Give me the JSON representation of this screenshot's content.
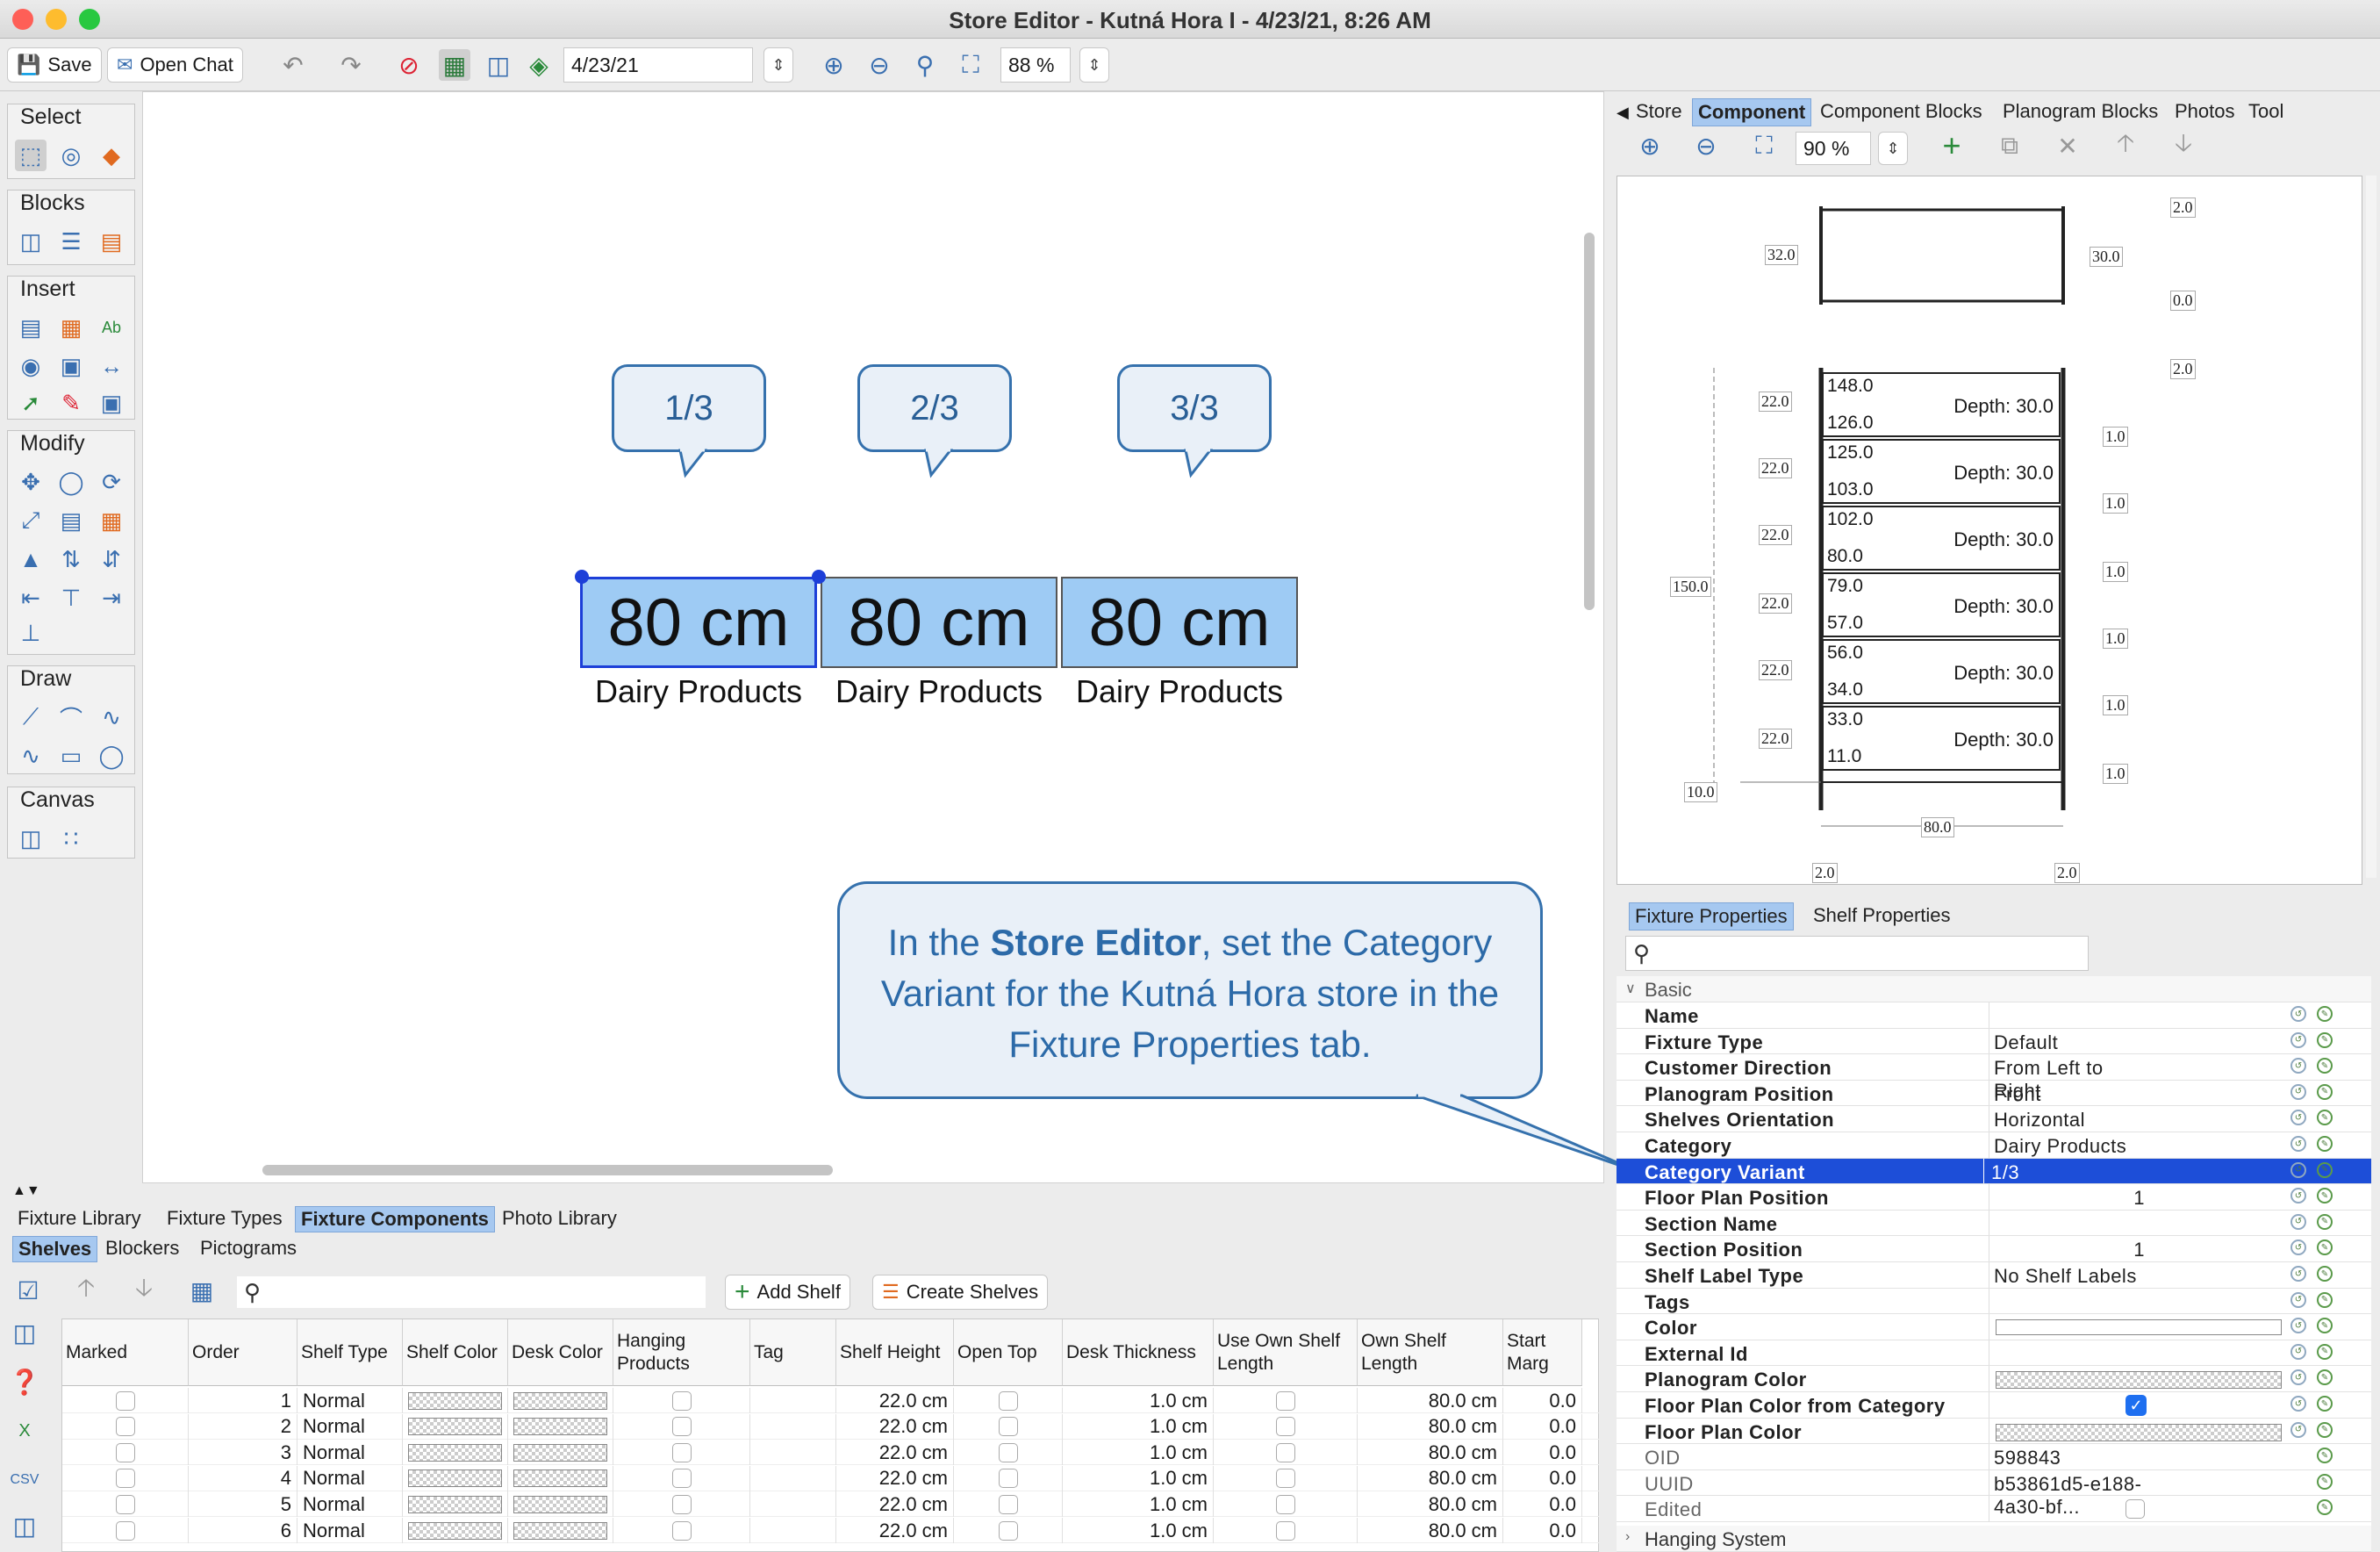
{
  "window": {
    "title": "Store Editor - Kutná Hora I - 4/23/21, 8:26 AM"
  },
  "toolbar": {
    "save_label": "Save",
    "open_chat_label": "Open Chat",
    "date_value": "4/23/21",
    "zoom_value": "88 %"
  },
  "palette": {
    "groups": [
      "Select",
      "Blocks",
      "Insert",
      "Modify",
      "Draw",
      "Canvas"
    ]
  },
  "canvas": {
    "labels": [
      "1/3",
      "2/3",
      "3/3"
    ],
    "shelf_lengths": [
      "80 cm",
      "80 cm",
      "80 cm"
    ],
    "categories": [
      "Dairy Products",
      "Dairy Products",
      "Dairy Products"
    ]
  },
  "callout": {
    "pre": "In the ",
    "bold": "Store Editor",
    "post": ", set the Category Variant for the Kutná Hora store in the Fixture Properties tab."
  },
  "right_tabs": [
    "Store",
    "Component",
    "Component Blocks",
    "Planogram Blocks",
    "Photos",
    "Tool"
  ],
  "right_zoom": "90 %",
  "preview": {
    "top_dims": [
      "2.0",
      "32.0",
      "30.0",
      "0.0",
      "2.0"
    ],
    "shelves": [
      {
        "top": "148.0",
        "bottom": "126.0",
        "depth": "Depth: 30.0",
        "h": "22.0",
        "t": "1.0"
      },
      {
        "top": "125.0",
        "bottom": "103.0",
        "depth": "Depth: 30.0",
        "h": "22.0",
        "t": "1.0"
      },
      {
        "top": "102.0",
        "bottom": "80.0",
        "depth": "Depth: 30.0",
        "h": "22.0",
        "t": "1.0"
      },
      {
        "top": "79.0",
        "bottom": "57.0",
        "depth": "Depth: 30.0",
        "h": "22.0",
        "t": "1.0"
      },
      {
        "top": "56.0",
        "bottom": "34.0",
        "depth": "Depth: 30.0",
        "h": "22.0",
        "t": "1.0"
      },
      {
        "top": "33.0",
        "bottom": "11.0",
        "depth": "Depth: 30.0",
        "h": "22.0",
        "t": "1.0"
      }
    ],
    "total_height": "150.0",
    "base": "10.0",
    "width": "80.0",
    "side_left": "2.0",
    "side_right": "2.0"
  },
  "prop_tabs": [
    "Fixture Properties",
    "Shelf Properties"
  ],
  "properties": {
    "group_basic": "Basic",
    "rows": [
      {
        "name": "Name",
        "value": ""
      },
      {
        "name": "Fixture Type",
        "value": "Default"
      },
      {
        "name": "Customer Direction",
        "value": "From Left to Right"
      },
      {
        "name": "Planogram Position",
        "value": "Front"
      },
      {
        "name": "Shelves Orientation",
        "value": "Horizontal"
      },
      {
        "name": "Category",
        "value": "Dairy Products"
      },
      {
        "name": "Category Variant",
        "value": "1/3"
      },
      {
        "name": "Floor Plan Position",
        "value": "1"
      },
      {
        "name": "Section Name",
        "value": ""
      },
      {
        "name": "Section Position",
        "value": "1"
      },
      {
        "name": "Shelf Label Type",
        "value": "No Shelf Labels"
      },
      {
        "name": "Tags",
        "value": ""
      },
      {
        "name": "Color",
        "value": ""
      },
      {
        "name": "External Id",
        "value": ""
      },
      {
        "name": "Planogram Color",
        "value": ""
      },
      {
        "name": "Floor Plan Color from Category",
        "value": ""
      },
      {
        "name": "Floor Plan Color",
        "value": ""
      },
      {
        "name": "OID",
        "value": "598843"
      },
      {
        "name": "UUID",
        "value": "b53861d5-e188-4a30-bf..."
      },
      {
        "name": "Edited",
        "value": ""
      }
    ],
    "group_hanging": "Hanging System"
  },
  "bottom_tabs": [
    "Fixture Library",
    "Fixture Types",
    "Fixture Components",
    "Photo Library"
  ],
  "sub_tabs": [
    "Shelves",
    "Blockers",
    "Pictograms"
  ],
  "shelf_toolbar": {
    "add_shelf": "Add Shelf",
    "create_shelves": "Create Shelves"
  },
  "shelf_table": {
    "headers": [
      "Marked",
      "Order",
      "Shelf Type",
      "Shelf Color",
      "Desk Color",
      "Hanging Products",
      "Tag",
      "Shelf Height",
      "Open Top",
      "Desk Thickness",
      "Use Own Shelf Length",
      "Own Shelf Length",
      "Start Marg"
    ],
    "rows": [
      {
        "order": "1",
        "type": "Normal",
        "height": "22.0 cm",
        "thickness": "1.0 cm",
        "own_length": "80.0 cm",
        "start": "0.0"
      },
      {
        "order": "2",
        "type": "Normal",
        "height": "22.0 cm",
        "thickness": "1.0 cm",
        "own_length": "80.0 cm",
        "start": "0.0"
      },
      {
        "order": "3",
        "type": "Normal",
        "height": "22.0 cm",
        "thickness": "1.0 cm",
        "own_length": "80.0 cm",
        "start": "0.0"
      },
      {
        "order": "4",
        "type": "Normal",
        "height": "22.0 cm",
        "thickness": "1.0 cm",
        "own_length": "80.0 cm",
        "start": "0.0"
      },
      {
        "order": "5",
        "type": "Normal",
        "height": "22.0 cm",
        "thickness": "1.0 cm",
        "own_length": "80.0 cm",
        "start": "0.0"
      },
      {
        "order": "6",
        "type": "Normal",
        "height": "22.0 cm",
        "thickness": "1.0 cm",
        "own_length": "80.0 cm",
        "start": "0.0"
      }
    ]
  },
  "colors": {
    "accent": "#3571ad",
    "selection": "#1d4ed8",
    "tab_selected": "#a6c8f0",
    "shelf_fill": "#9ecbf4"
  }
}
